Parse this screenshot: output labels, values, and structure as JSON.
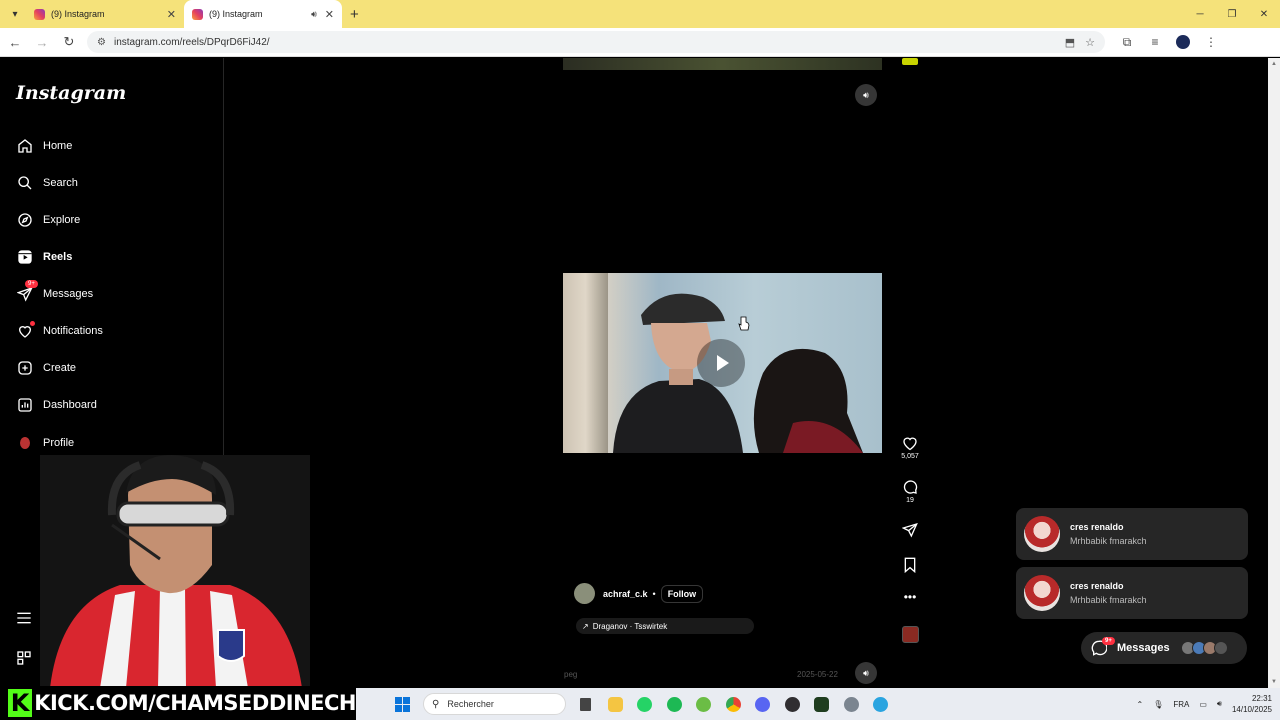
{
  "browser": {
    "tabs": [
      {
        "title": "(9) Instagram",
        "active": false
      },
      {
        "title": "(9) Instagram",
        "active": true
      }
    ],
    "url": "instagram.com/reels/DPqrD6FiJ42/"
  },
  "sidebar": {
    "logo": "Instagram",
    "items": [
      {
        "label": "Home",
        "icon": "home-icon"
      },
      {
        "label": "Search",
        "icon": "search-icon"
      },
      {
        "label": "Explore",
        "icon": "compass-icon"
      },
      {
        "label": "Reels",
        "icon": "reels-icon"
      },
      {
        "label": "Messages",
        "icon": "messenger-icon",
        "badge": "9+"
      },
      {
        "label": "Notifications",
        "icon": "heart-icon"
      },
      {
        "label": "Create",
        "icon": "plus-square-icon"
      },
      {
        "label": "Dashboard",
        "icon": "chart-icon"
      },
      {
        "label": "Profile",
        "icon": "avatar-icon"
      }
    ]
  },
  "reel": {
    "likes": "5,057",
    "comments": "19",
    "author": "achraf_c.k",
    "follow_label": "Follow",
    "separator": "•",
    "music": "Draganov · Tsswirtek",
    "faded_caption": "peg",
    "faded_date": "2025-05-22"
  },
  "toasts": [
    {
      "name": "cres renaldo",
      "message": "Mrhbabik fmarakch"
    },
    {
      "name": "cres renaldo",
      "message": "Mrhbabik fmarakch"
    }
  ],
  "messages_pill": {
    "label": "Messages",
    "badge": "9+"
  },
  "overlay": {
    "kick_letter": "K",
    "kick_text": "KICK.COM/CHAMSEDDINECH"
  },
  "taskbar": {
    "search_placeholder": "Rechercher",
    "lang": "FRA",
    "time": "22:31",
    "date": "14/10/2025"
  },
  "colors": {
    "kick_green": "#53fc18",
    "badge_red": "#ff3040",
    "instagram_bg": "#000000"
  }
}
